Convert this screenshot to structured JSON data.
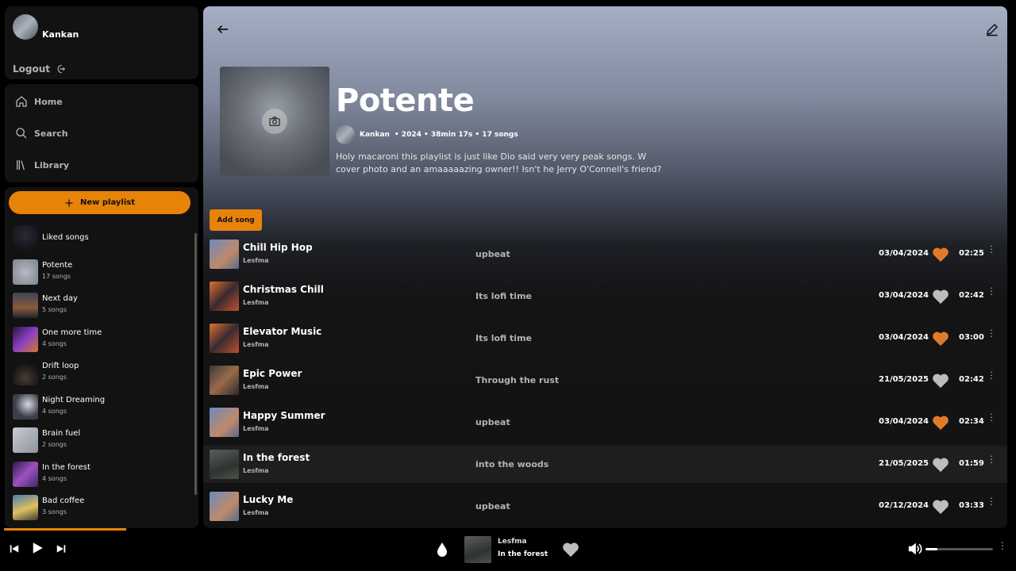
{
  "user": {
    "name": "Kankan",
    "logout_label": "Logout"
  },
  "nav": {
    "home": "Home",
    "search": "Search",
    "library": "Library"
  },
  "library": {
    "new_playlist_label": "New playlist",
    "items": [
      {
        "name": "Liked songs",
        "sub": ""
      },
      {
        "name": "Potente",
        "sub": "17 songs"
      },
      {
        "name": "Next day",
        "sub": "5 songs"
      },
      {
        "name": "One more time",
        "sub": "4 songs"
      },
      {
        "name": "Drift loop",
        "sub": "2 songs"
      },
      {
        "name": "Night Dreaming",
        "sub": "4 songs"
      },
      {
        "name": "Brain fuel",
        "sub": "2 songs"
      },
      {
        "name": "In the forest",
        "sub": "4 songs"
      },
      {
        "name": "Bad coffee",
        "sub": "3 songs"
      }
    ]
  },
  "playlist": {
    "title": "Potente",
    "owner": "Kankan",
    "meta": "• 2024 •  38min 17s • 17 songs",
    "description": "Holy macaroni this playlist is just like Dio said very very peak songs. W cover photo and an amaaaaazing owner!! Isn't he Jerry O'Connell's friend?",
    "add_song_label": "Add song"
  },
  "songs": [
    {
      "title": "Chill Hip Hop",
      "artist": "Lesfma",
      "album": "upbeat",
      "date": "03/04/2024",
      "liked": true,
      "duration": "02:25"
    },
    {
      "title": "Christmas Chill",
      "artist": "Lesfma",
      "album": "Its lofi time",
      "date": "03/04/2024",
      "liked": false,
      "duration": "02:42"
    },
    {
      "title": "Elevator Music",
      "artist": "Lesfma",
      "album": "Its lofi time",
      "date": "03/04/2024",
      "liked": true,
      "duration": "03:00"
    },
    {
      "title": "Epic Power",
      "artist": "Lesfma",
      "album": "Through the rust",
      "date": "21/05/2025",
      "liked": false,
      "duration": "02:42"
    },
    {
      "title": "Happy Summer",
      "artist": "Lesfma",
      "album": "upbeat",
      "date": "03/04/2024",
      "liked": true,
      "duration": "02:34"
    },
    {
      "title": "In the forest",
      "artist": "Lesfma",
      "album": "into the woods",
      "date": "21/05/2025",
      "liked": false,
      "duration": "01:59"
    },
    {
      "title": "Lucky Me",
      "artist": "Lesfma",
      "album": "upbeat",
      "date": "02/12/2024",
      "liked": false,
      "duration": "03:33"
    }
  ],
  "player": {
    "artist": "Lesfma",
    "title": "In the forest",
    "progress_fraction": 0.12,
    "volume_fraction": 0.18
  },
  "colors": {
    "accent": "#e8830a",
    "heart_liked": "#e07b2a",
    "heart_unliked": "#bdbdbd"
  }
}
